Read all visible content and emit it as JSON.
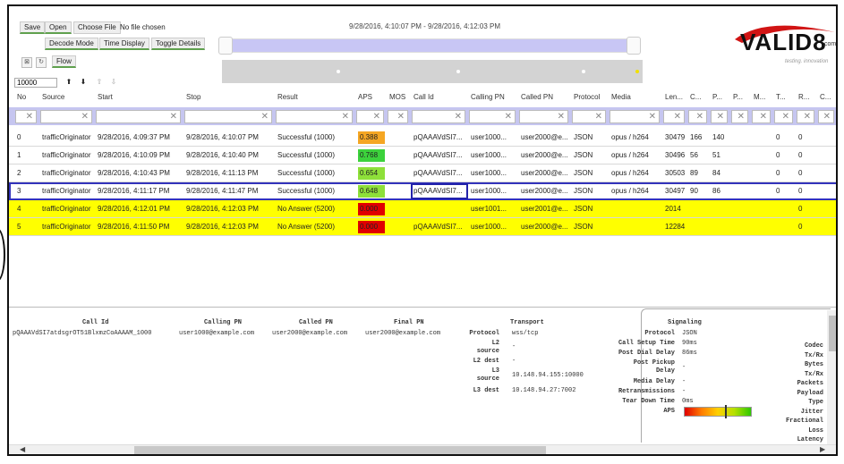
{
  "toolbar": {
    "save_label": "Save",
    "open_label": "Open",
    "choose_file_label": "Choose File",
    "no_file_text": "No file chosen",
    "decode_mode_label": "Decode Mode",
    "time_display_label": "Time Display",
    "toggle_details_label": "Toggle Details",
    "flow_label": "Flow",
    "count_value": "10000"
  },
  "time_range": "9/28/2016, 4:10:07 PM - 9/28/2016, 4:12:03 PM",
  "logo": {
    "text": "VALID8",
    "suffix": ".com",
    "tagline": "testing. innovation"
  },
  "columns": [
    "No",
    "Source",
    "Start",
    "Stop",
    "Result",
    "APS",
    "MOS",
    "Call Id",
    "Calling PN",
    "Called PN",
    "Protocol",
    "Media",
    "Len...",
    "C...",
    "P...",
    "P...",
    "M...",
    "T...",
    "R...",
    "C..."
  ],
  "rows": [
    {
      "no": "0",
      "source": "trafficOriginator",
      "start": "9/28/2016, 4:09:37 PM",
      "stop": "9/28/2016, 4:10:07 PM",
      "result": "Successful (1000)",
      "aps": "0.388",
      "aps_color": "#f5a623",
      "callid": "pQAAAVdSI7...",
      "calling": "user1000...",
      "called": "user2000@e...",
      "protocol": "JSON",
      "media": "opus / h264",
      "len": "30479",
      "c": "166",
      "p": "140",
      "t": "0",
      "r": "0",
      "hl": false
    },
    {
      "no": "1",
      "source": "trafficOriginator",
      "start": "9/28/2016, 4:10:09 PM",
      "stop": "9/28/2016, 4:10:40 PM",
      "result": "Successful (1000)",
      "aps": "0.768",
      "aps_color": "#3cd23c",
      "callid": "pQAAAVdSI7...",
      "calling": "user1000...",
      "called": "user2000@e...",
      "protocol": "JSON",
      "media": "opus / h264",
      "len": "30496",
      "c": "56",
      "p": "51",
      "t": "0",
      "r": "0",
      "hl": false
    },
    {
      "no": "2",
      "source": "trafficOriginator",
      "start": "9/28/2016, 4:10:43 PM",
      "stop": "9/28/2016, 4:11:13 PM",
      "result": "Successful (1000)",
      "aps": "0.654",
      "aps_color": "#8ee03a",
      "callid": "pQAAAVdSI7...",
      "calling": "user1000...",
      "called": "user2000@e...",
      "protocol": "JSON",
      "media": "opus / h264",
      "len": "30503",
      "c": "89",
      "p": "84",
      "t": "0",
      "r": "0",
      "hl": false
    },
    {
      "no": "3",
      "source": "trafficOriginator",
      "start": "9/28/2016, 4:11:17 PM",
      "stop": "9/28/2016, 4:11:47 PM",
      "result": "Successful (1000)",
      "aps": "0.648",
      "aps_color": "#8ee03a",
      "callid": "pQAAAVdSI7...",
      "calling": "user1000...",
      "called": "user2000@e...",
      "protocol": "JSON",
      "media": "opus / h264",
      "len": "30497",
      "c": "90",
      "p": "86",
      "t": "0",
      "r": "0",
      "hl": false
    },
    {
      "no": "4",
      "source": "trafficOriginator",
      "start": "9/28/2016, 4:12:01 PM",
      "stop": "9/28/2016, 4:12:03 PM",
      "result": "No Answer (5200)",
      "aps": "0.000",
      "aps_color": "#e00000",
      "callid": "",
      "calling": "user1001...",
      "called": "user2001@e...",
      "protocol": "JSON",
      "media": "",
      "len": "2014",
      "c": "",
      "p": "",
      "t": "",
      "r": "0",
      "hl": true
    },
    {
      "no": "5",
      "source": "trafficOriginator",
      "start": "9/28/2016, 4:11:50 PM",
      "stop": "9/28/2016, 4:12:03 PM",
      "result": "No Answer (5200)",
      "aps": "0.000",
      "aps_color": "#e00000",
      "callid": "pQAAAVdSI7...",
      "calling": "user1000...",
      "called": "user2000@e...",
      "protocol": "JSON",
      "media": "",
      "len": "12284",
      "c": "",
      "p": "",
      "t": "",
      "r": "0",
      "hl": true
    }
  ],
  "detail": {
    "headers": {
      "callid": "Call Id",
      "calling": "Calling PN",
      "called": "Called PN",
      "final": "Final PN",
      "transport": "Transport",
      "signaling": "Signaling"
    },
    "callid": "pQAAAVdSI7atdsgrOT51BlxmzCoAAAAM_1000",
    "calling": "user1000@example.com",
    "called": "user2000@example.com",
    "final": "user2000@example.com",
    "transport": {
      "protocol_label": "Protocol",
      "protocol": "wss/tcp",
      "l2src_label_a": "L2",
      "l2src_label_b": "source",
      "l2src": "-",
      "l2dst_label": "L2 dest",
      "l2dst": "-",
      "l3src_label_a": "L3",
      "l3src_label_b": "source",
      "l3src": "10.148.94.155:10000",
      "l3dst_label": "L3 dest",
      "l3dst": "10.148.94.27:7002"
    },
    "signaling": {
      "protocol_label": "Protocol",
      "protocol": "JSON",
      "setup_label": "Call Setup Time",
      "setup": "90ms",
      "pdd_label": "Post Dial Delay",
      "pdd": "86ms",
      "ppd_label_a": "Post Pickup",
      "ppd_label_b": "Delay",
      "ppd": "-",
      "media_label": "Media Delay",
      "media": "-",
      "retrans_label": "Retransmissions",
      "retrans": "-",
      "teardown_label": "Tear Down Time",
      "teardown": "0ms",
      "aps_label": "APS"
    },
    "right_labels": [
      "Codec",
      "Tx/Rx",
      "Bytes",
      "Tx/Rx",
      "Packets",
      "Payload",
      "Type",
      "Jitter",
      "Fractional",
      "Loss",
      "Latency"
    ]
  }
}
